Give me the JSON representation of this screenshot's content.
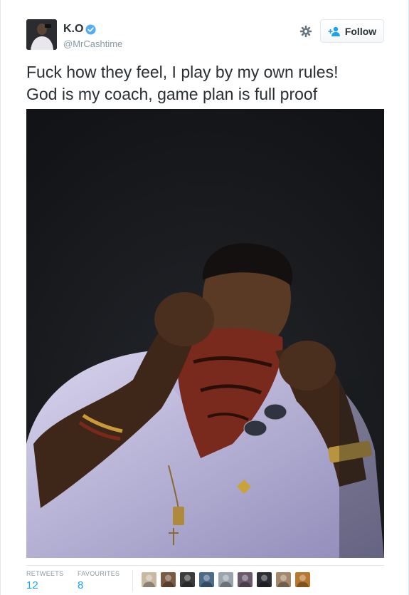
{
  "user": {
    "display_name": "K.O",
    "handle": "@MrCashtime",
    "verified": true,
    "avatar_icon": "avatar-photo"
  },
  "header": {
    "settings_icon": "gear-icon",
    "follow_label": "Follow",
    "follow_icon": "person-add-icon"
  },
  "tweet": {
    "lines": [
      "Fuck how they feel, I play by my own rules!",
      "God is my coach, game plan is full proof"
    ]
  },
  "stats": {
    "retweets_label": "RETWEETS",
    "retweets_count": "12",
    "favourites_label": "FAVOURITES",
    "favourites_count": "8"
  },
  "favoriters": [
    {
      "color": "#c9b8a2"
    },
    {
      "color": "#7a5a40"
    },
    {
      "color": "#3b3b3b"
    },
    {
      "color": "#4a6b8a"
    },
    {
      "color": "#9aa4ae"
    },
    {
      "color": "#6b5a6e"
    },
    {
      "color": "#2c2c34"
    },
    {
      "color": "#a3876b"
    },
    {
      "color": "#b6772f"
    }
  ],
  "colors": {
    "link_blue": "#1da1f2",
    "verified_blue": "#55acee",
    "muted": "#8899a6",
    "text": "#292f33"
  }
}
